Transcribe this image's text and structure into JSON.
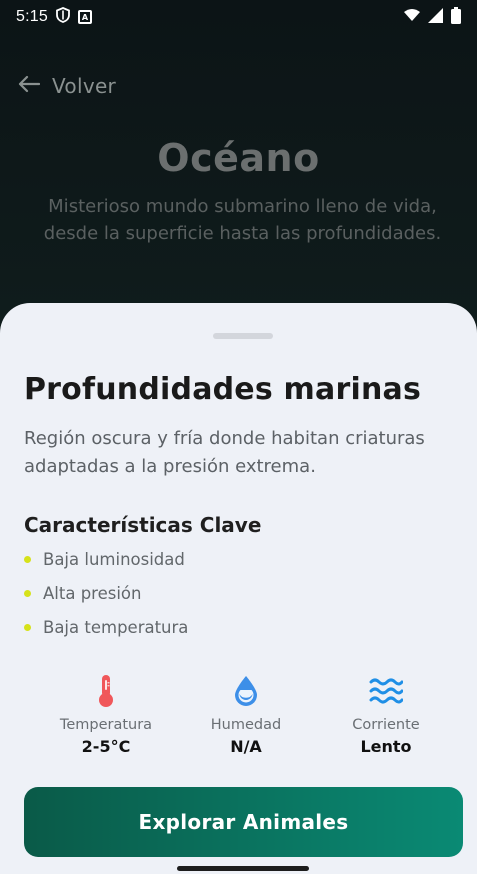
{
  "status_bar": {
    "time": "5:15",
    "a_badge": "A"
  },
  "header": {
    "back_label": "Volver",
    "title": "Océano",
    "description": "Misterioso mundo submarino lleno de vida, desde la superficie hasta las profundidades."
  },
  "sheet": {
    "title": "Profundidades marinas",
    "description": "Región oscura y fría donde habitan criaturas adaptadas a la presión extrema.",
    "features_title": "Características Clave",
    "features": [
      "Baja luminosidad",
      "Alta presión",
      "Baja temperatura"
    ],
    "stats": [
      {
        "icon": "thermometer-icon",
        "label": "Temperatura",
        "value": "2-5°C"
      },
      {
        "icon": "water-drop-icon",
        "label": "Humedad",
        "value": "N/A"
      },
      {
        "icon": "waves-icon",
        "label": "Corriente",
        "value": "Lento"
      }
    ],
    "cta_label": "Explorar Animales"
  },
  "colors": {
    "accent_dot": "#d6e21a",
    "thermometer": "#f0575a",
    "drop": "#3d8fe8",
    "waves": "#1f8fe6",
    "cta_start": "#0a5a48",
    "cta_end": "#0a8a74"
  }
}
